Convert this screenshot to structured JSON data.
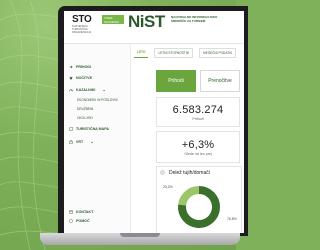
{
  "header": {
    "logo_left_title": "STO",
    "logo_left_subtitle": "SLOVENSKA TURISTIČNA ORGANIZACIJA",
    "badge_lines": [
      "I FEEL",
      "SLOVENIA"
    ],
    "logo_nist": "NiST",
    "logo_nist_subtitle": "NACIONALNO INFORMACIJSKO SREDIŠČE ZA TURIZEM"
  },
  "sidebar": {
    "items": [
      {
        "label": "PRIHODI",
        "icon": "arrow-in-icon"
      },
      {
        "label": "NOČITVE",
        "icon": "star-icon"
      },
      {
        "label": "KAZALNIKI",
        "icon": "gauge-icon",
        "expanded": true
      },
      {
        "label": "TURISTIČNA MAPA",
        "icon": "map-icon"
      },
      {
        "label": "VRT",
        "icon": "bag-icon"
      }
    ],
    "sub_items": [
      "EKONOMSKI IN POSLOVNI",
      "DRUŽBENI",
      "OKOLJSKI"
    ],
    "footer": [
      "KONTAKT",
      "POMOČ"
    ]
  },
  "tabs": [
    "LETO",
    "LETNI STOPNOSTNI",
    "MESEČNI PODATKI"
  ],
  "segment": {
    "options": [
      "Prihodi",
      "Prenočitve"
    ],
    "selected": "Prihodi"
  },
  "cards": {
    "total_value": "6.583.274",
    "total_caption": "Prihodi",
    "change_value": "+6,3%",
    "change_caption": "Glede na leo prej"
  },
  "chart_data": {
    "type": "pie",
    "title": "Delež tujih/domači",
    "categories": [
      "Domači",
      "Tuji"
    ],
    "values": [
      23.2,
      76.8
    ],
    "labels": [
      "23,2%",
      "76,8%"
    ],
    "colors": [
      "#9cc66a",
      "#3a6f2c"
    ]
  },
  "colors": {
    "accent": "#6aa63d",
    "dark_green": "#2e5a2e"
  }
}
